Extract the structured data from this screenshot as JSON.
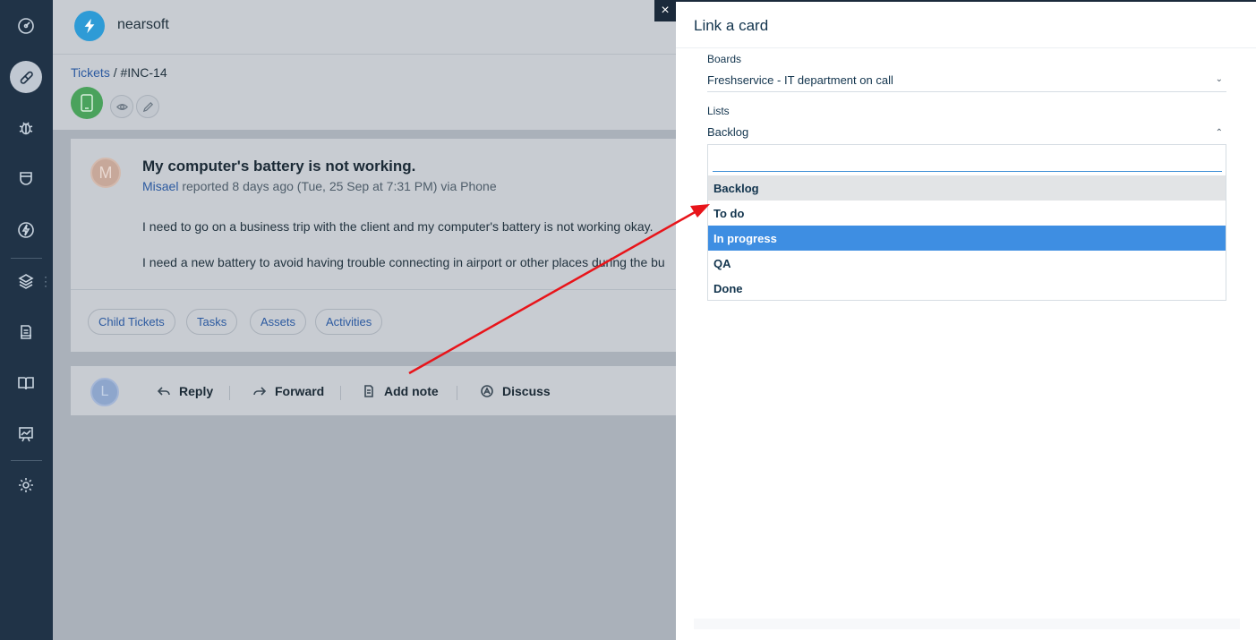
{
  "sidebar": {
    "icons": [
      "dashboard-icon",
      "tickets-icon",
      "problems-icon",
      "changes-icon",
      "releases-icon",
      "assets-icon",
      "contracts-icon",
      "solutions-icon",
      "reports-icon",
      "settings-icon"
    ],
    "active": "tickets-icon"
  },
  "header": {
    "brand": "nearsoft"
  },
  "breadcrumb": {
    "link": "Tickets",
    "separator": " / ",
    "current": "#INC-14"
  },
  "ticket": {
    "avatar_initial": "M",
    "title": "My computer's battery is not working.",
    "requester": "Misael",
    "meta": " reported 8 days ago (Tue, 25 Sep at 7:31 PM) via Phone",
    "body_line1": "I need to go on a business trip with the client and my computer's battery is not working okay.",
    "body_line2": "I need a new battery to avoid having trouble connecting in airport or other places during the bu",
    "tabs": [
      "Child Tickets",
      "Tasks",
      "Assets",
      "Activities"
    ]
  },
  "reply_bar": {
    "avatar_initial": "L",
    "actions": [
      "Reply",
      "Forward",
      "Add note",
      "Discuss"
    ]
  },
  "close_label": "×",
  "panel": {
    "title": "Link a card",
    "boards_label": "Boards",
    "boards_value": "Freshservice - IT department on call",
    "lists_label": "Lists",
    "lists_value": "Backlog",
    "search_value": "",
    "options": [
      "Backlog",
      "To do",
      "In progress",
      "QA",
      "Done"
    ],
    "hovered_option": "Backlog",
    "selected_option": "In progress"
  },
  "colors": {
    "sidebar": "#203347",
    "accent": "#3e8ee2",
    "annotation_arrow": "#e8141a"
  }
}
